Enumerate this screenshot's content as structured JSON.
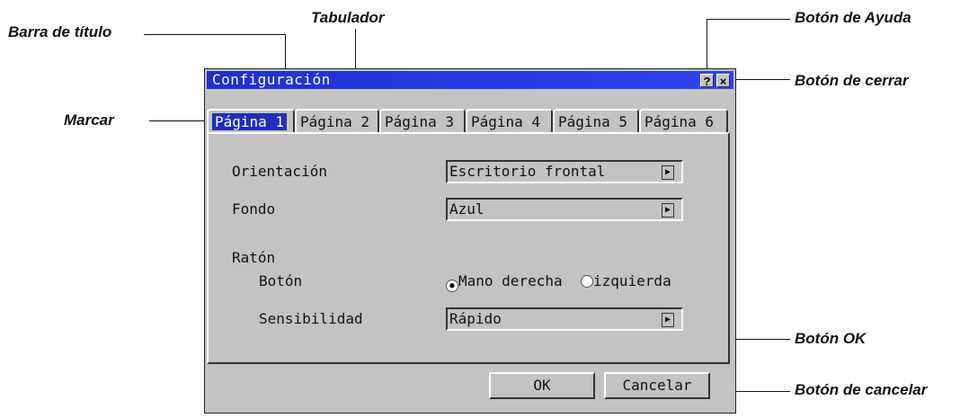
{
  "callouts": {
    "tabulador": "Tabulador",
    "barra_titulo": "Barra de título",
    "boton_ayuda": "Botón de Ayuda",
    "boton_cerrar": "Botón de cerrar",
    "marcar": "Marcar",
    "boton_ok": "Botón OK",
    "boton_cancelar": "Botón de cancelar"
  },
  "dialog": {
    "title": "Configuración",
    "help_icon": "?",
    "close_icon": "×",
    "tabs": [
      "Página 1",
      "Página 2",
      "Página 3",
      "Página 4",
      "Página 5",
      "Página 6"
    ],
    "active_tab": 0,
    "orientacion_label": "Orientación",
    "orientacion_value": "Escritorio frontal",
    "fondo_label": "Fondo",
    "fondo_value": "Azul",
    "raton_label": "Ratón",
    "boton_label": "Botón",
    "radio_right": "Mano derecha",
    "radio_left": "izquierda",
    "sensibilidad_label": "Sensibilidad",
    "sensibilidad_value": "Rápido",
    "ok_label": "OK",
    "cancel_label": "Cancelar"
  }
}
